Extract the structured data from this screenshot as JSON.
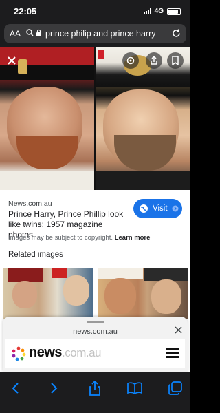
{
  "status_bar": {
    "time": "22:05",
    "network": "4G"
  },
  "url_bar": {
    "text_size_label": "AA",
    "query": "prince philip and prince harry"
  },
  "image_viewer": {
    "close_icon": "close-icon",
    "action_icons": [
      "lens-icon",
      "share-icon",
      "bookmark-icon"
    ]
  },
  "result": {
    "source": "News.com.au",
    "title": "Prince Harry, Prince Phillip look like twins: 1957 magazine photos",
    "visit_label": "Visit",
    "copyright_text": "Images may be subject to copyright.",
    "learn_more": "Learn more"
  },
  "related": {
    "heading": "Related images"
  },
  "sheet": {
    "url": "news.com.au",
    "logo_main": "news",
    "logo_suffix": ".com.au"
  },
  "toolbar": {
    "icons": [
      "back-icon",
      "forward-icon",
      "share-icon",
      "bookmarks-icon",
      "tabs-icon"
    ]
  },
  "colors": {
    "accent": "#1a73e8",
    "toolbar_icon": "#0a84ff",
    "chrome": "#1c1c1e"
  }
}
